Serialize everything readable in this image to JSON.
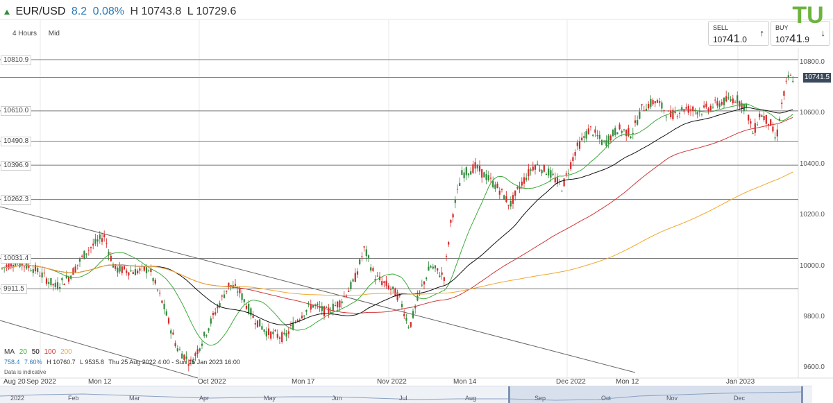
{
  "header": {
    "symbol": "EUR/USD",
    "change": "8.2",
    "change_pct": "0.08%",
    "high": "H 10743.8",
    "low": "L 10729.6"
  },
  "timeframe": {
    "interval": "4 Hours",
    "price_type": "Mid"
  },
  "sell": {
    "label": "SELL",
    "prefix": "107",
    "big": "41",
    "suffix": ".0",
    "arrow": "↑"
  },
  "buy": {
    "label": "BUY",
    "prefix": "107",
    "big": "41",
    "suffix": ".9",
    "arrow": "↓"
  },
  "logo_text": "TU",
  "current_price": "10741.5",
  "level_tags": [
    "10810.9",
    "10610.0",
    "10490.8",
    "10396.9",
    "10262.3",
    "10031.4",
    "9911.5"
  ],
  "y_axis": [
    "10800.0",
    "10600.0",
    "10400.0",
    "10200.0",
    "10000.0",
    "9800.0",
    "9600.0"
  ],
  "x_axis": [
    "Aug 20",
    "Sep 2022",
    "Mon 12",
    "Oct 2022",
    "Mon 17",
    "Nov 2022",
    "Mon 14",
    "Dec 2022",
    "Mon 12",
    "Jan 2023"
  ],
  "legend": {
    "ma": "MA",
    "p1": "20",
    "p2": "50",
    "p3": "100",
    "p4": "200"
  },
  "stats": {
    "a": "758.4",
    "b": "7.60%",
    "h": "H 10760.7",
    "l": "L 9535.8",
    "range": "Thu 25 Aug 2022 4:00 - Sun 15 Jan 2023 16:00"
  },
  "indicative": "Data is indicative",
  "navigator": [
    "2022",
    "Feb",
    "Mar",
    "Apr",
    "May",
    "Jun",
    "Jul",
    "Aug",
    "Sep",
    "Oct",
    "Nov",
    "Dec"
  ],
  "colors": {
    "up": "#2f8a3b",
    "down": "#d42a2a",
    "ma20": "#3daa3d",
    "ma50": "#111111",
    "ma100": "#d03838",
    "ma200": "#f0a830",
    "tag_bg": "#3a4a5c",
    "logo": "#6cb33f"
  }
}
